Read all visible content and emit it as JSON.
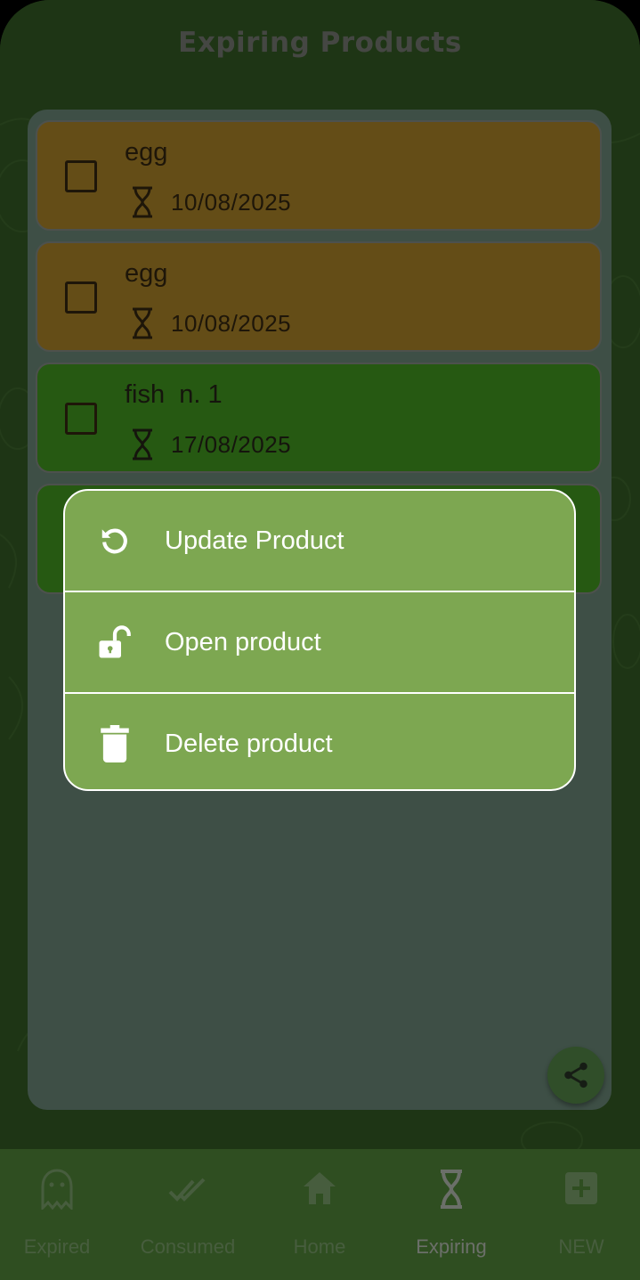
{
  "app": {
    "title": "Expiring Products"
  },
  "products": [
    {
      "name": "egg",
      "date": "10/08/2025",
      "status": "orange"
    },
    {
      "name": "egg",
      "date": "10/08/2025",
      "status": "orange"
    },
    {
      "name": "fish  n. 1",
      "date": "17/08/2025",
      "status": "green"
    },
    {
      "name": "",
      "date": "",
      "status": "green"
    }
  ],
  "fab": {
    "icon": "share-icon"
  },
  "context_menu": {
    "items": [
      {
        "label": "Update Product",
        "icon": "refresh-icon"
      },
      {
        "label": "Open product",
        "icon": "unlock-icon"
      },
      {
        "label": "Delete product",
        "icon": "trash-icon"
      }
    ]
  },
  "nav": {
    "items": [
      {
        "label": "Expired",
        "icon": "ghost-icon",
        "active": false
      },
      {
        "label": "Consumed",
        "icon": "double-check-icon",
        "active": false
      },
      {
        "label": "Home",
        "icon": "home-icon",
        "active": false
      },
      {
        "label": "Expiring",
        "icon": "hourglass-icon",
        "active": true
      },
      {
        "label": "NEW",
        "icon": "add-box-icon",
        "active": false
      }
    ]
  },
  "colors": {
    "background": "#3d6b2a",
    "panel": "#7c9f8c",
    "card_orange": "#c99a2e",
    "card_green": "#4cb225",
    "menu": "#7da751",
    "navbar": "#5f9c42"
  }
}
